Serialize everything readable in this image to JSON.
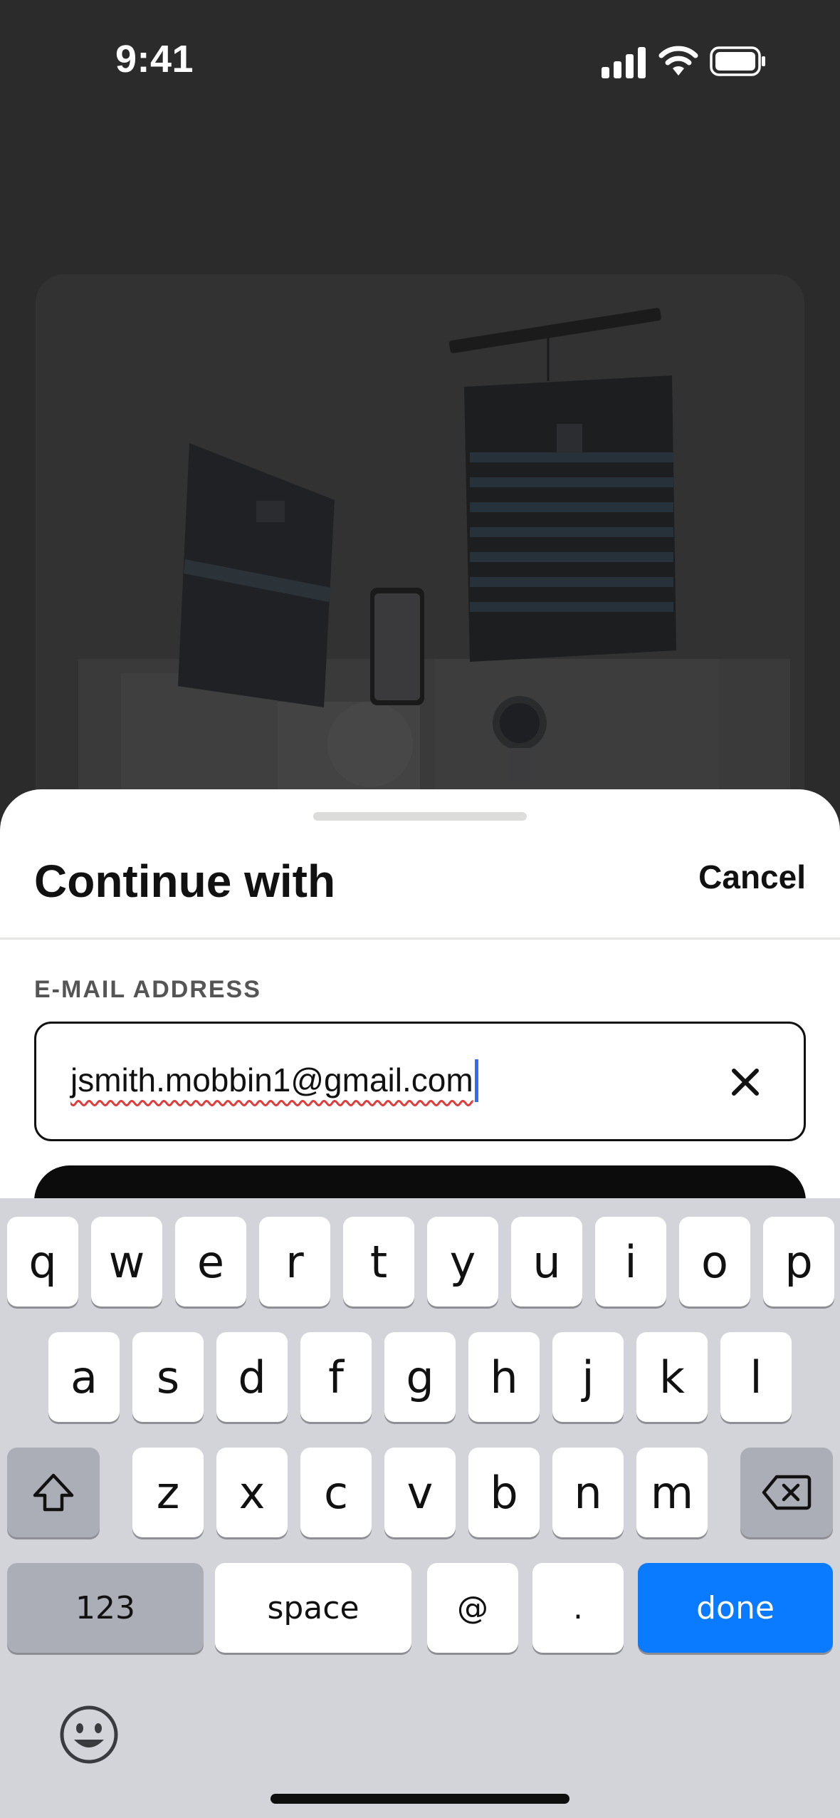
{
  "status_bar": {
    "time": "9:41"
  },
  "sheet": {
    "title": "Continue with",
    "cancel_label": "Cancel",
    "email_label": "E-MAIL ADDRESS",
    "email_value": "jsmith.mobbin1@gmail.com"
  },
  "keyboard": {
    "row1": [
      "q",
      "w",
      "e",
      "r",
      "t",
      "y",
      "u",
      "i",
      "o",
      "p"
    ],
    "row2": [
      "a",
      "s",
      "d",
      "f",
      "g",
      "h",
      "j",
      "k",
      "l"
    ],
    "row3": [
      "z",
      "x",
      "c",
      "v",
      "b",
      "n",
      "m"
    ],
    "numbers_label": "123",
    "space_label": "space",
    "at_label": "@",
    "dot_label": ".",
    "done_label": "done"
  },
  "icons": {
    "signal": "cellular-signal-icon",
    "wifi": "wifi-icon",
    "battery": "battery-icon",
    "clear": "clear-x-icon",
    "shift": "shift-arrow-icon",
    "backspace": "backspace-icon",
    "emoji": "emoji-smiley-icon"
  },
  "colors": {
    "accent": "#0a7bff",
    "backdrop": "#2b2b2c",
    "primary_button": "#0c0c0c"
  }
}
